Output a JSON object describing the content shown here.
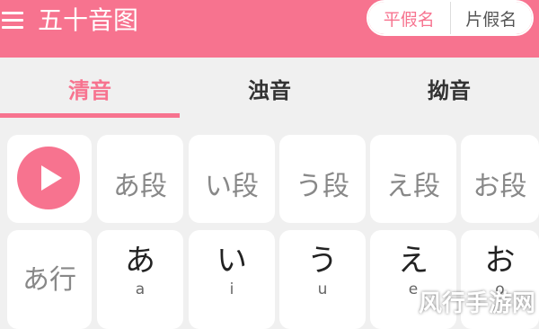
{
  "header": {
    "title": "五十音图",
    "toggle": {
      "hiragana": "平假名",
      "katakana": "片假名",
      "selected": "hiragana"
    }
  },
  "tabs": [
    {
      "label": "清音",
      "active": true
    },
    {
      "label": "浊音",
      "active": false
    },
    {
      "label": "拗音",
      "active": false
    }
  ],
  "dan_row": [
    "あ段",
    "い段",
    "う段",
    "え段",
    "お段"
  ],
  "rows": [
    {
      "label": "あ行",
      "cells": [
        {
          "kana": "あ",
          "romaji": "a"
        },
        {
          "kana": "い",
          "romaji": "i"
        },
        {
          "kana": "う",
          "romaji": "u"
        },
        {
          "kana": "え",
          "romaji": "e"
        },
        {
          "kana": "お",
          "romaji": "o"
        }
      ]
    }
  ],
  "watermark": "风行手游网",
  "colors": {
    "accent": "#f7738f",
    "background": "#f0f0f0",
    "card": "#ffffff"
  }
}
